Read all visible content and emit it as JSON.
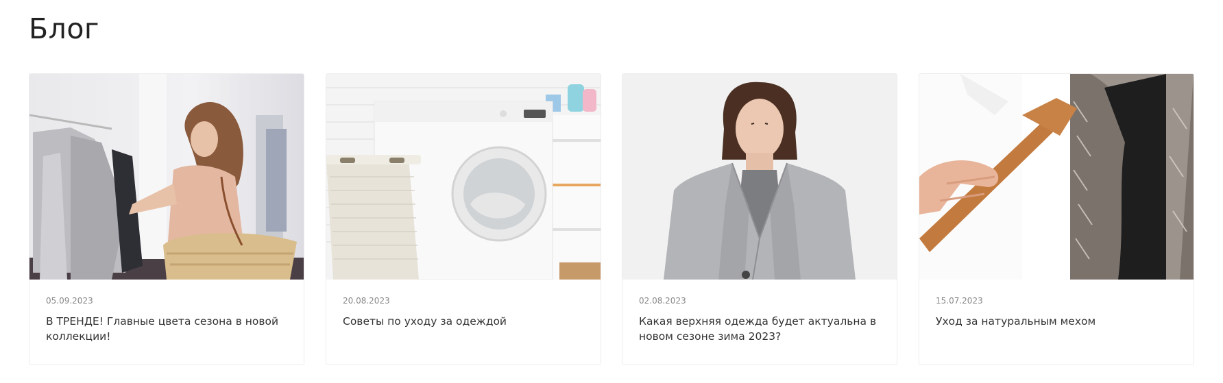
{
  "blog": {
    "title": "Блог",
    "posts": [
      {
        "date": "05.09.2023",
        "title": "В ТРЕНДЕ! Главные цвета сезона в новой коллекции!",
        "image": "woman-shopping-clothes-rack"
      },
      {
        "date": "20.08.2023",
        "title": "Советы по уходу за одеждой",
        "image": "washing-machine-laundry-basket"
      },
      {
        "date": "02.08.2023",
        "title": "Какая верхняя одежда будет актуальна в новом сезоне зима 2023?",
        "image": "woman-grey-coat"
      },
      {
        "date": "15.07.2023",
        "title": "Уход за натуральным мехом",
        "image": "brushing-fur-coat"
      }
    ]
  }
}
